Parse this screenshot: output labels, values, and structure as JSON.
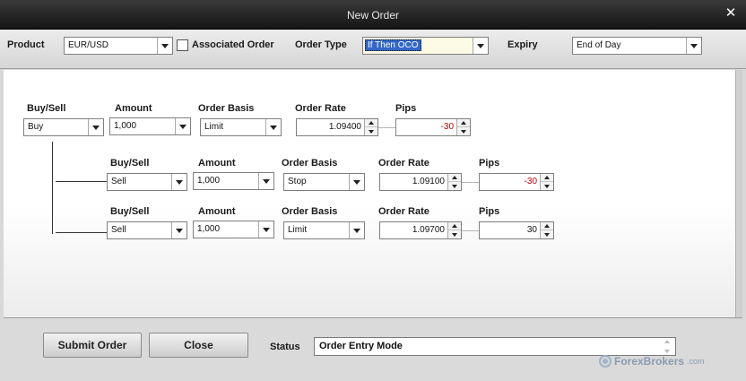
{
  "window": {
    "title": "New Order"
  },
  "top": {
    "product_label": "Product",
    "product_value": "EUR/USD",
    "associated_label": "Associated Order",
    "order_type_label": "Order Type",
    "order_type_value": "If Then OCO",
    "expiry_label": "Expiry",
    "expiry_value": "End of Day"
  },
  "columns": {
    "buy_sell": "Buy/Sell",
    "amount": "Amount",
    "order_basis": "Order Basis",
    "order_rate": "Order Rate",
    "pips": "Pips"
  },
  "orders": [
    {
      "side": "Buy",
      "amount": "1,000",
      "basis": "Limit",
      "rate": "1.09400",
      "pips": "-30",
      "pips_negative": true
    },
    {
      "side": "Sell",
      "amount": "1,000",
      "basis": "Stop",
      "rate": "1.09100",
      "pips": "-30",
      "pips_negative": true
    },
    {
      "side": "Sell",
      "amount": "1,000",
      "basis": "Limit",
      "rate": "1.09700",
      "pips": "30",
      "pips_negative": false
    }
  ],
  "bottom": {
    "submit_label": "Submit Order",
    "close_label": "Close",
    "status_label": "Status",
    "status_value": "Order Entry Mode"
  },
  "watermark": {
    "brand": "ForexBrokers",
    "domain": ".com"
  },
  "colors": {
    "titlebar": "#1f1f1f",
    "selection": "#3268c8",
    "negative": "#c00000"
  }
}
